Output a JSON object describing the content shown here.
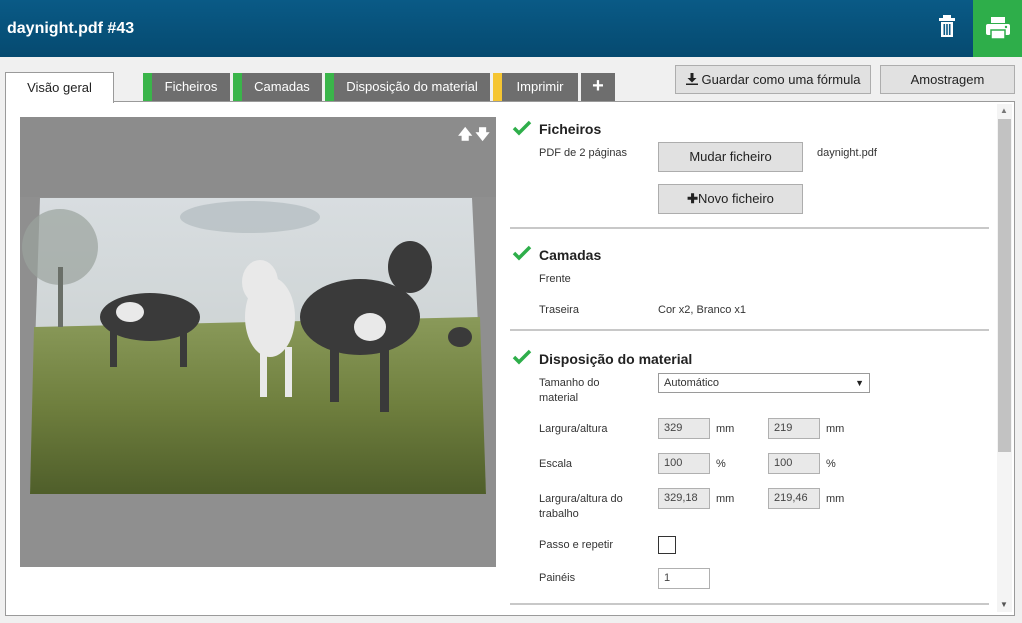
{
  "window": {
    "title": "daynight.pdf #43"
  },
  "icons": {
    "trash": "trash-icon",
    "print": "printer-icon",
    "download": "download-icon",
    "plus": "plus-icon",
    "check": "check-icon"
  },
  "colors": {
    "header": "#054a70",
    "print_button": "#2eae4a",
    "tab_green": "#3ab54a",
    "tab_yellow": "#f5c532",
    "tab_gray": "#6e6e6e",
    "check": "#2eae4a"
  },
  "tabs": [
    {
      "label": "Visão geral",
      "active": true
    },
    {
      "label": "Ficheiros",
      "status": "green"
    },
    {
      "label": "Camadas",
      "status": "green"
    },
    {
      "label": "Disposição do material",
      "status": "green"
    },
    {
      "label": "Imprimir",
      "status": "yellow"
    }
  ],
  "tab_add": "+",
  "toolbar": {
    "save_formula": "Guardar como uma fórmula",
    "sample": "Amostragem"
  },
  "preview": {
    "arrows": "🡅🡇"
  },
  "files": {
    "title": "Ficheiros",
    "desc": "PDF de 2 páginas",
    "change_button": "Mudar ficheiro",
    "filename": "daynight.pdf",
    "new_file_button": "Novo ficheiro"
  },
  "layers": {
    "title": "Camadas",
    "front_label": "Frente",
    "back_label": "Traseira",
    "back_value": "Cor x2, Branco x1"
  },
  "layout": {
    "title": "Disposição do material",
    "media_size_label": "Tamanho do material",
    "media_size_value": "Automático",
    "wh_label": "Largura/altura",
    "width": "329",
    "height": "219",
    "unit_mm": "mm",
    "scale_label": "Escala",
    "scale_x": "100",
    "scale_y": "100",
    "unit_pct": "%",
    "job_wh_label": "Largura/altura do trabalho",
    "job_width": "329,18",
    "job_height": "219,46",
    "step_repeat_label": "Passo e repetir",
    "panels_label": "Painéis",
    "panels_value": "1"
  }
}
